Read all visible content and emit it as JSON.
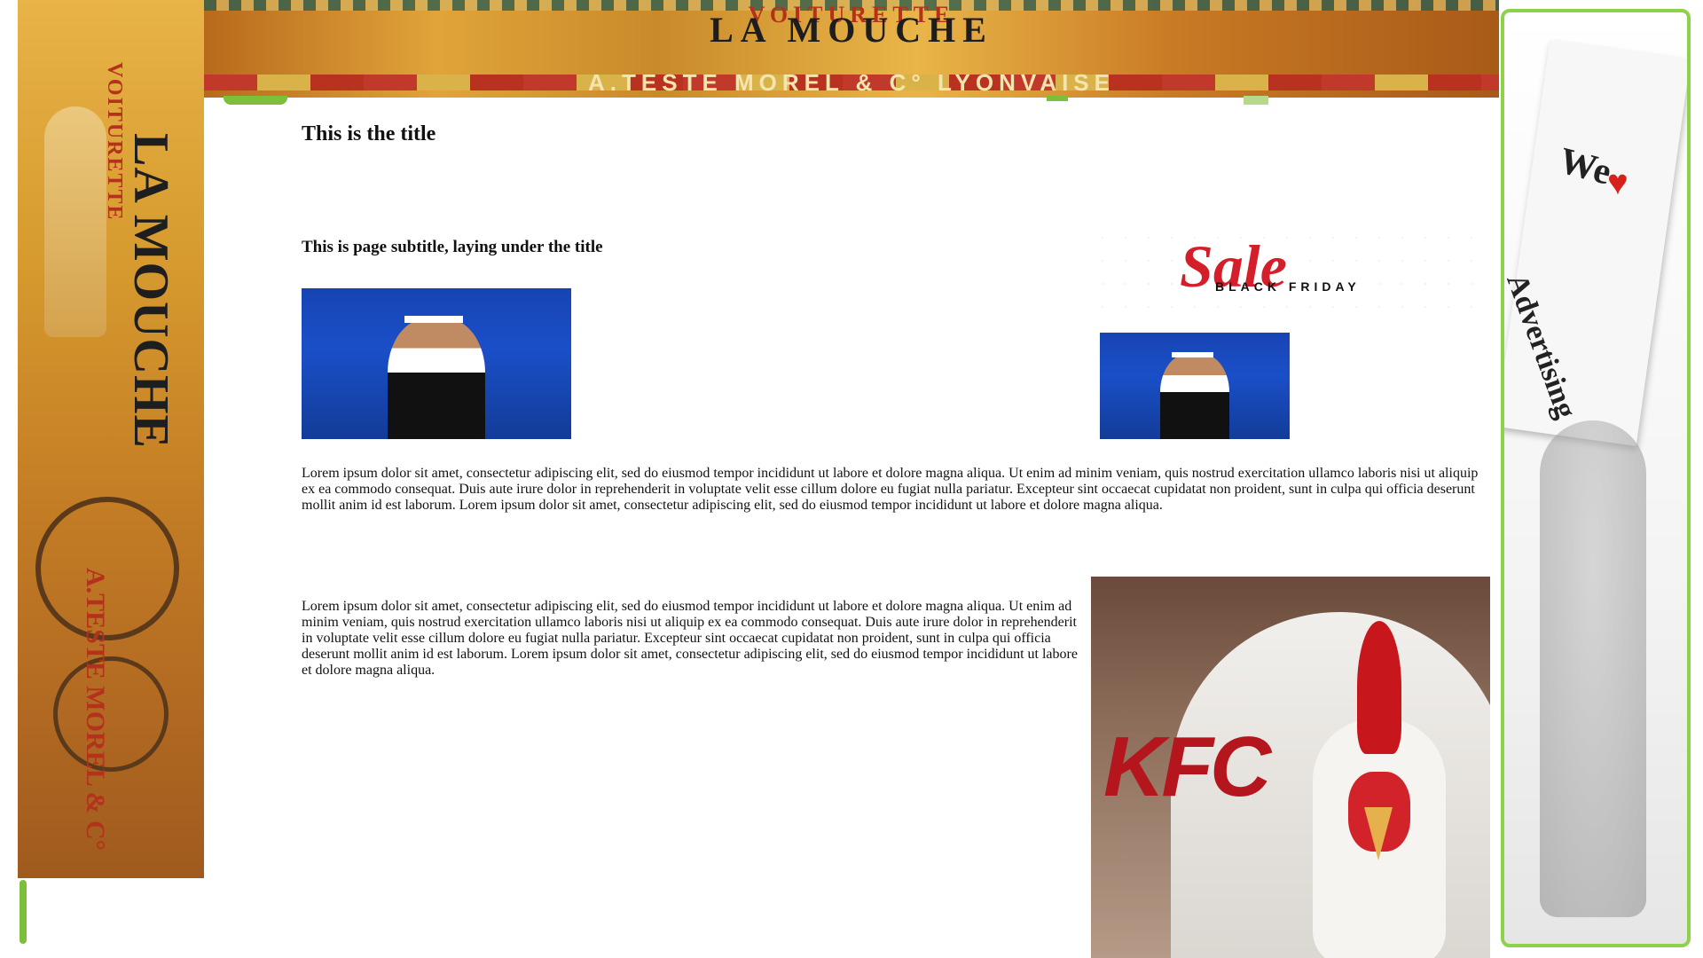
{
  "page": {
    "title": "This is the title",
    "subtitle": "This is page subtitle, laying under the title",
    "paragraph_1": "Lorem ipsum dolor sit amet, consectetur adipiscing elit, sed do eiusmod tempor incididunt ut labore et dolore magna aliqua. Ut enim ad minim veniam, quis nostrud exercitation ullamco laboris nisi ut aliquip ex ea commodo consequat. Duis aute irure dolor in reprehenderit in voluptate velit esse cillum dolore eu fugiat nulla pariatur. Excepteur sint occaecat cupidatat non proident, sunt in culpa qui officia deserunt mollit anim id est laborum. Lorem ipsum dolor sit amet, consectetur adipiscing elit, sed do eiusmod tempor incididunt ut labore et dolore magna aliqua.",
    "paragraph_2": "Lorem ipsum dolor sit amet, consectetur adipiscing elit, sed do eiusmod tempor incididunt ut labore et dolore magna aliqua. Ut enim ad minim veniam, quis nostrud exercitation ullamco laboris nisi ut aliquip ex ea commodo consequat. Duis aute irure dolor in reprehenderit in voluptate velit esse cillum dolore eu fugiat nulla pariatur. Excepteur sint occaecat cupidatat non proident, sunt in culpa qui officia deserunt mollit anim id est laborum. Lorem ipsum dolor sit amet, consectetur adipiscing elit, sed do eiusmod tempor incididunt ut labore et dolore magna aliqua."
  },
  "top_banner": {
    "line_top": "VOITURETTE",
    "line_main": "LA MOUCHE",
    "line_bottom": "A.TESTE MOREL & C° LYONVAISE"
  },
  "left_poster": {
    "line_top": "VOITURETTE",
    "line_main": "LA MOUCHE",
    "line_bottom": "A.TESTE MOREL & C°"
  },
  "ads": {
    "sale_word": "Sale",
    "sale_tagline": "BLACK FRIDAY",
    "right_sign_line1": "We",
    "right_sign_line2": "Advertising",
    "kfc_logo": "KFC"
  },
  "colors": {
    "accent_green": "#8ed14a",
    "sale_red": "#d41f2b",
    "kfc_red": "#b5161d",
    "tennis_blue": "#1a4fc8"
  }
}
